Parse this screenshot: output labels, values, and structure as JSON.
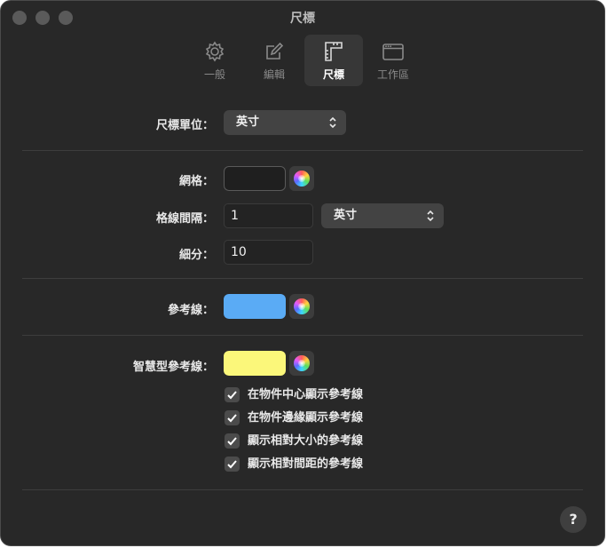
{
  "window": {
    "title": "尺標"
  },
  "toolbar": {
    "items": [
      {
        "label": "一般",
        "icon": "gear-icon",
        "active": false
      },
      {
        "label": "編輯",
        "icon": "edit-icon",
        "active": false
      },
      {
        "label": "尺標",
        "icon": "ruler-icon",
        "active": true
      },
      {
        "label": "工作區",
        "icon": "workspace-icon",
        "active": false
      }
    ]
  },
  "ruler_units": {
    "label": "尺標單位：",
    "value": "英寸"
  },
  "grid": {
    "label": "網格：",
    "color": "#1f1f1f",
    "spacing_label": "格線間隔：",
    "spacing_value": "1",
    "spacing_unit": "英寸",
    "subdivisions_label": "細分：",
    "subdivisions_value": "10"
  },
  "guides": {
    "label": "參考線：",
    "color": "#5aabf5"
  },
  "smart_guides": {
    "label": "智慧型參考線：",
    "color": "#fbf77a",
    "options": [
      {
        "label": "在物件中心顯示參考線",
        "checked": true
      },
      {
        "label": "在物件邊緣顯示參考線",
        "checked": true
      },
      {
        "label": "顯示相對大小的參考線",
        "checked": true
      },
      {
        "label": "顯示相對間距的參考線",
        "checked": true
      }
    ]
  },
  "help": {
    "label": "?"
  }
}
